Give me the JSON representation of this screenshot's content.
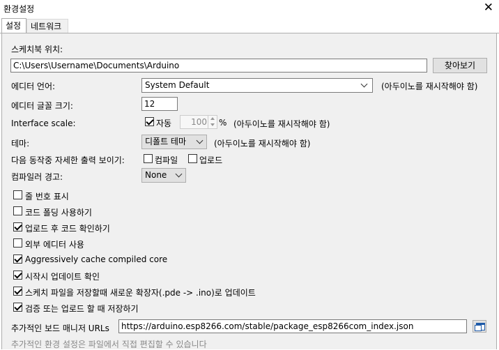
{
  "window": {
    "title": "환경설정"
  },
  "tabs": [
    {
      "label": "설정"
    },
    {
      "label": "네트워크"
    }
  ],
  "sketchbook": {
    "label": "스케치북 위치:",
    "path": "C:\\Users\\Username\\Documents\\Arduino",
    "browse_label": "찾아보기"
  },
  "editor_language": {
    "label": "에디터 언어:",
    "value": "System Default",
    "note": "(아두이노를 재시작해야 함)"
  },
  "editor_font_size": {
    "label": "에디터 글꼴 크기:",
    "value": "12"
  },
  "interface_scale": {
    "label": "Interface scale:",
    "auto_label": "자동",
    "auto_checked": true,
    "value": "100",
    "unit": "%",
    "note": "(아두이노를 재시작해야 함)"
  },
  "theme": {
    "label": "테마:",
    "value": "디폴트 테마",
    "note": "(아두이노를 재시작해야 함)"
  },
  "verbose_output": {
    "label": "다음 동작중 자세한 출력 보이기:",
    "compile_label": "컴파일",
    "compile_checked": false,
    "upload_label": "업로드",
    "upload_checked": false
  },
  "compiler_warnings": {
    "label": "컴파일러 경고:",
    "value": "None"
  },
  "options": [
    {
      "label": "줄 번호 표시",
      "checked": false
    },
    {
      "label": "코드 폴딩 사용하기",
      "checked": false
    },
    {
      "label": "업로드 후 코드 확인하기",
      "checked": true
    },
    {
      "label": "외부 에디터 사용",
      "checked": false
    },
    {
      "label": "Aggressively cache compiled core",
      "checked": true
    },
    {
      "label": "시작시 업데이트 확인",
      "checked": true
    },
    {
      "label": "스케치 파일을 저장할때 새로운 확장자(.pde -> .ino)로 업데이트",
      "checked": true
    },
    {
      "label": "검증 또는 업로드 할 때 저장하기",
      "checked": true
    }
  ],
  "board_manager": {
    "label": "추가적인 보드 매니저 URLs",
    "url": "https://arduino.esp8266.com/stable/package_esp8266com_index.json"
  },
  "footer": {
    "note": "추가적인 환경 설정은 파일에서 직접 편집할 수 있습니다"
  }
}
